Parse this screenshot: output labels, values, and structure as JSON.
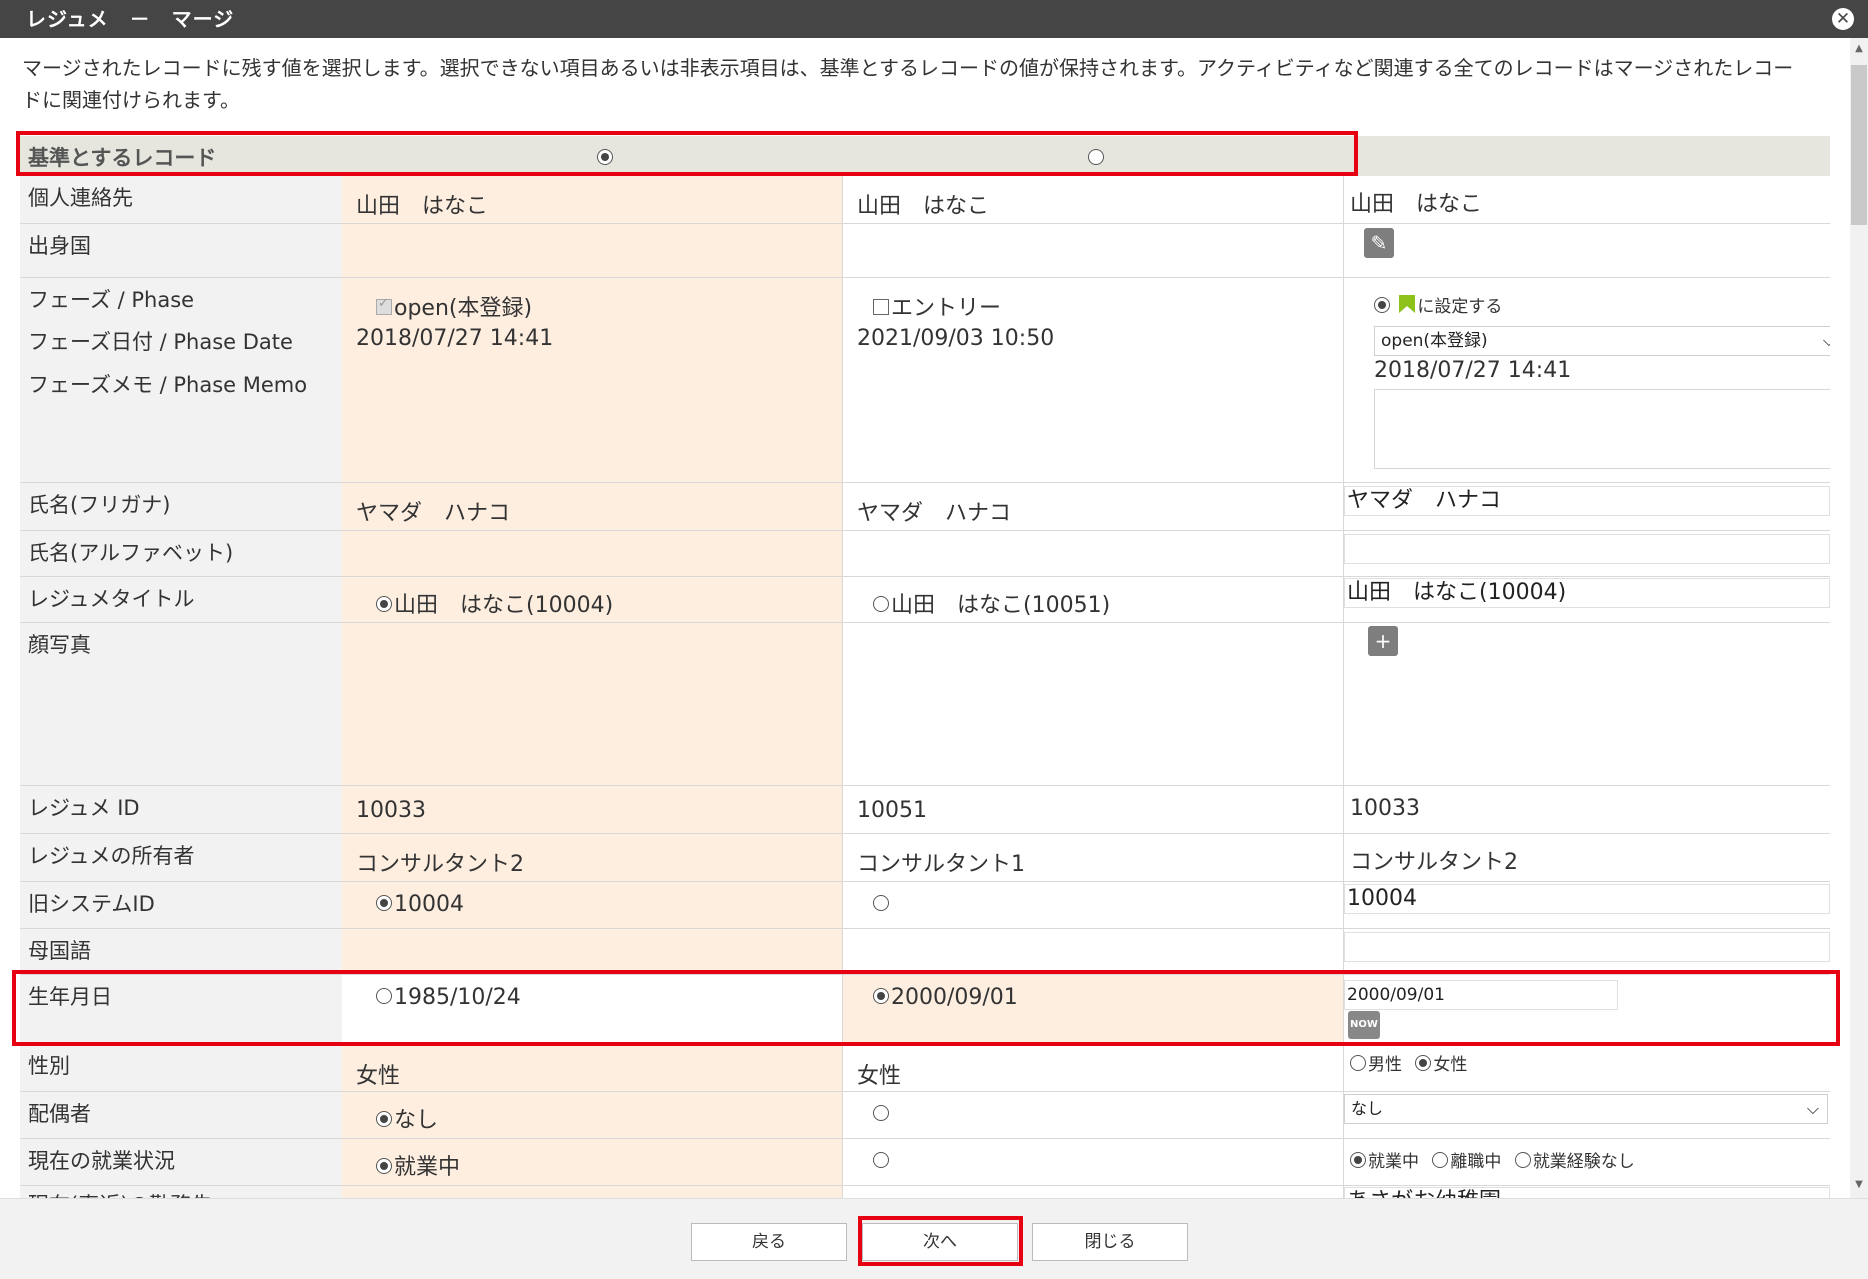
{
  "window": {
    "title": "レジュメ　－　マージ",
    "close_glyph": "✕"
  },
  "description": "マージされたレコードに残す値を選択します。選択できない項目あるいは非表示項目は、基準とするレコードの値が保持されます。アクティビティなど関連する全てのレコードはマージされたレコードに関連付けられます。",
  "header_row": {
    "label": "基準とするレコード"
  },
  "rows": {
    "contact": {
      "label": "個人連絡先",
      "c1": "山田　はなこ",
      "c2": "山田　はなこ",
      "c3": "山田　はなこ"
    },
    "country": {
      "label": "出身国"
    },
    "phase": {
      "label1": "フェーズ / Phase",
      "label2": "フェーズ日付 / Phase Date",
      "label3": "フェーズメモ / Phase Memo",
      "c1_value": "open(本登録)",
      "c1_date": "2018/07/27 14:41",
      "c2_value": "エントリー",
      "c2_date": "2021/09/03 10:50",
      "c3_set_label": "に設定する",
      "c3_select": "open(本登録)",
      "c3_date": "2018/07/27 14:41"
    },
    "kana": {
      "label": "氏名(フリガナ)",
      "c1": "ヤマダ　ハナコ",
      "c2": "ヤマダ　ハナコ",
      "c3": "ヤマダ　ハナコ"
    },
    "alpha": {
      "label": "氏名(アルファベット)"
    },
    "title": {
      "label": "レジュメタイトル",
      "c1": "山田　はなこ(10004)",
      "c2": "山田　はなこ(10051)",
      "c3": "山田　はなこ(10004)"
    },
    "photo": {
      "label": "顔写真",
      "add_glyph": "+"
    },
    "resume_id": {
      "label": "レジュメ ID",
      "c1": "10033",
      "c2": "10051",
      "c3": "10033"
    },
    "owner": {
      "label": "レジュメの所有者",
      "c1": "コンサルタント2",
      "c2": "コンサルタント1",
      "c3": "コンサルタント2"
    },
    "old_id": {
      "label": "旧システムID",
      "c1": "10004",
      "c3": "10004"
    },
    "native_lang": {
      "label": "母国語"
    },
    "birth": {
      "label": "生年月日",
      "c1": "1985/10/24",
      "c2": "2000/09/01",
      "c3": "2000/09/01",
      "now_label": "NOW"
    },
    "gender": {
      "label": "性別",
      "c1": "女性",
      "c2": "女性",
      "opt_male": "男性",
      "opt_female": "女性"
    },
    "spouse": {
      "label": "配偶者",
      "c1": "なし",
      "c3": "なし"
    },
    "employment": {
      "label": "現在の就業状況",
      "c1": "就業中",
      "opt1": "就業中",
      "opt2": "離職中",
      "opt3": "就業経験なし"
    },
    "employer": {
      "label": "現在(直近)の勤務先",
      "c3": "あさがお幼稚園"
    }
  },
  "footer": {
    "back": "戻る",
    "next": "次へ",
    "close": "閉じる"
  },
  "colors": {
    "highlight": "#fdeee0",
    "red_box": "#e60012",
    "title_bar": "#454545",
    "label_bg": "#f2f2f2",
    "phase_flag": "#8cc21a"
  }
}
